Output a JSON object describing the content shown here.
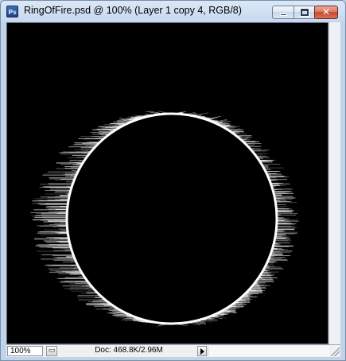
{
  "window": {
    "title": "RingOfFire.psd @ 100% (Layer 1 copy 4, RGB/8)",
    "app_icon_text": "Ps",
    "close_glyph": "✕"
  },
  "statusbar": {
    "zoom": "100%",
    "doc_info": "Doc: 468.8K/2.96M"
  },
  "colors": {
    "canvas": "#000000",
    "ring": "#ffffff",
    "title_bar": "#c7d9ef",
    "close_button": "#c7472c"
  },
  "icons": {
    "app": "photoshop-icon",
    "minimize": "minimize-icon",
    "maximize": "maximize-icon",
    "close": "close-icon",
    "status_menu": "status-menu-icon",
    "status_arrow": "play-arrow-icon",
    "resize": "resize-grip-icon"
  }
}
